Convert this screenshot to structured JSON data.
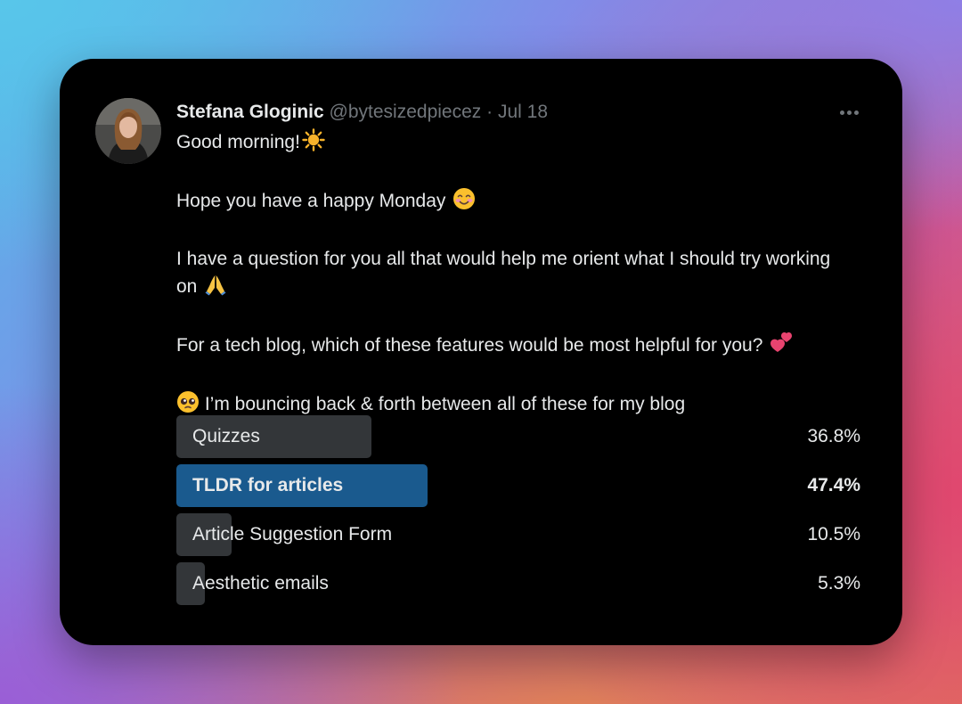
{
  "tweet": {
    "author": {
      "name": "Stefana Gloginic",
      "handle": "@bytesizedpiecez",
      "avatar_icon": "profile-photo"
    },
    "separator": "·",
    "date": "Jul 18",
    "more_icon": "more-horizontal-icon",
    "paragraphs": [
      {
        "text": "Good morning!",
        "emoji": "sun-icon"
      },
      {
        "text": "Hope you have a happy Monday ",
        "emoji": "smiling-face-icon"
      },
      {
        "text": "I have a question for you all that would help me orient what I should try working on ",
        "emoji": "folded-hands-icon"
      },
      {
        "text": "For a tech blog, which of these features would be most helpful for you? ",
        "emoji": "two-hearts-icon"
      },
      {
        "text": " I’m bouncing back & forth between all of these for my blog",
        "emoji": "pleading-face-icon"
      }
    ]
  },
  "poll": {
    "options": [
      {
        "label": "Quizzes",
        "percent_text": "36.8%",
        "percent": 36.8,
        "winner": false
      },
      {
        "label": "TLDR for articles",
        "percent_text": "47.4%",
        "percent": 47.4,
        "winner": true
      },
      {
        "label": "Article Suggestion Form",
        "percent_text": "10.5%",
        "percent": 10.5,
        "winner": false
      },
      {
        "label": "Aesthetic emails",
        "percent_text": "5.3%",
        "percent": 5.3,
        "winner": false
      }
    ]
  },
  "colors": {
    "card_background": "#000000",
    "primary_text": "#e7e9ea",
    "secondary_text": "#71767b",
    "poll_bar": "#333639",
    "poll_bar_winner": "#1a5a8e"
  }
}
